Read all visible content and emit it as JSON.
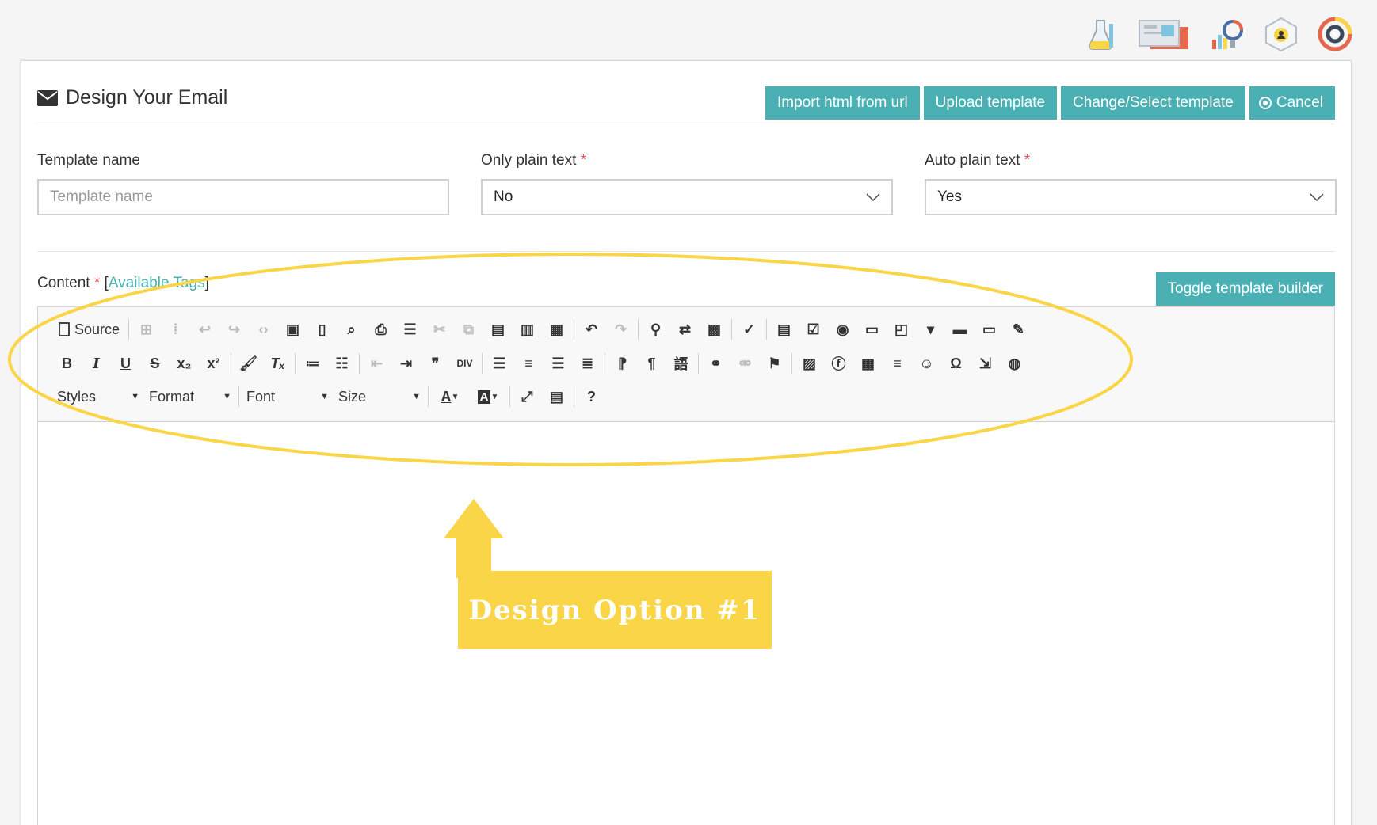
{
  "top_icons": [
    {
      "name": "flask-icon"
    },
    {
      "name": "newspaper-icon"
    },
    {
      "name": "chart-lightbulb-icon"
    },
    {
      "name": "network-user-icon"
    },
    {
      "name": "target-gear-icon"
    }
  ],
  "header": {
    "title": "Design Your Email",
    "buttons": {
      "import": "Import html from url",
      "upload": "Upload template",
      "change": "Change/Select template",
      "cancel": "Cancel"
    }
  },
  "form": {
    "template_name": {
      "label": "Template name",
      "placeholder": "Template name",
      "value": ""
    },
    "only_plain_text": {
      "label": "Only plain text",
      "required": "*",
      "value": "No"
    },
    "auto_plain_text": {
      "label": "Auto plain text",
      "required": "*",
      "value": "Yes"
    }
  },
  "content": {
    "label": "Content",
    "required": "*",
    "bracket_open": "[",
    "tags_link": "Available Tags",
    "bracket_close": "]",
    "toggle_button": "Toggle template builder"
  },
  "toolbar": {
    "source_label": "Source",
    "styles": "Styles",
    "format": "Format",
    "font": "Font",
    "size": "Size",
    "help": "?"
  },
  "annotation": {
    "callout_text": "Design Option #1",
    "color": "#f9d547"
  },
  "colors": {
    "accent": "#4ab0b4",
    "required": "#e05555"
  }
}
